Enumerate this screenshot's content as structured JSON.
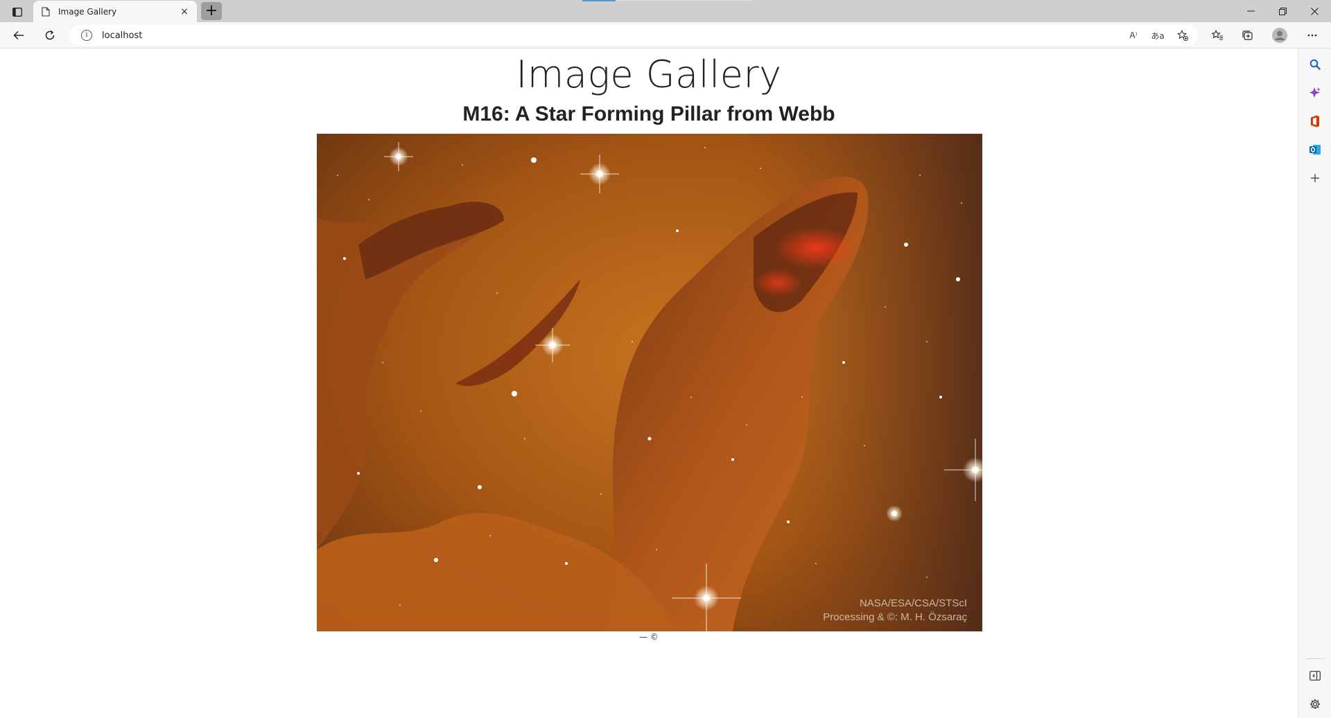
{
  "browser": {
    "tab_title": "Image Gallery",
    "tab_close": "×",
    "new_tab": "+",
    "url": "localhost",
    "info_glyph": "i",
    "read_aloud": "A⁾",
    "translate": "あa"
  },
  "page": {
    "title": "Image Gallery",
    "image_title": "M16: A Star Forming Pillar from Webb",
    "image_credit_line1": "NASA/ESA/CSA/STScI",
    "image_credit_line2": "Processing & ©: M. H. Özsaraç",
    "caption": "— ©"
  },
  "colors": {
    "accent": "#4a9bd8",
    "copilot": "#8a3fd1",
    "office": "#d83b01",
    "outlook": "#0a64ad",
    "search": "#1a63c9"
  }
}
